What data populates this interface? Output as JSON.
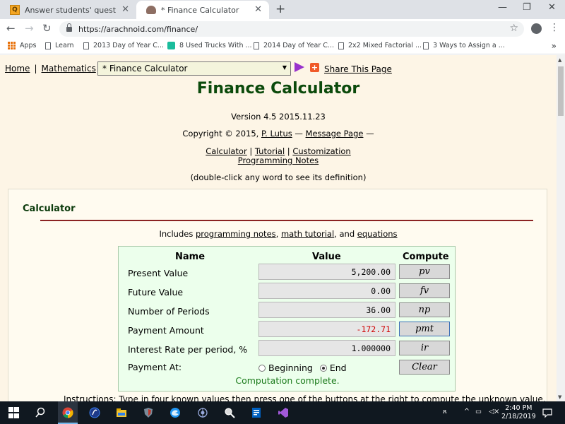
{
  "browser": {
    "tabs": [
      {
        "title": "Answer students' questions and l",
        "active": false
      },
      {
        "title": "* Finance Calculator",
        "active": true
      }
    ],
    "url": "https://arachnoid.com/finance/",
    "bookmarks": [
      "Apps",
      "Learn",
      "2013 Day of Year C...",
      "8 Used Trucks With ...",
      "2014 Day of Year C...",
      "2x2 Mixed Factorial ...",
      "3 Ways to Assign a ..."
    ]
  },
  "page": {
    "nav": {
      "home": "Home",
      "mathematics": "Mathematics",
      "select_value": "* Finance Calculator",
      "share": "Share This Page"
    },
    "title": "Finance Calculator",
    "version": "Version 4.5 2015.11.23",
    "copyright_prefix": "Copyright © 2015,",
    "author": "P. Lutus",
    "dash1": "—",
    "message_page": "Message Page",
    "dash2": "—",
    "links": {
      "calculator": "Calculator",
      "tutorial": "Tutorial",
      "customization": "Customization",
      "programming_notes": "Programming Notes"
    },
    "hint": "(double-click any word to see its definition)",
    "calculator": {
      "section_title": "Calculator",
      "includes_prefix": "Includes",
      "includes_link1": "programming notes",
      "includes_link2": "math tutorial",
      "includes_and": ", and",
      "includes_link3": "equations",
      "headers": {
        "name": "Name",
        "value": "Value",
        "compute": "Compute"
      },
      "rows": [
        {
          "label": "Present Value",
          "value": "5,200.00",
          "button": "pv"
        },
        {
          "label": "Future Value",
          "value": "0.00",
          "button": "fv"
        },
        {
          "label": "Number of Periods",
          "value": "36.00",
          "button": "np"
        },
        {
          "label": "Payment Amount",
          "value": "-172.71",
          "button": "pmt"
        },
        {
          "label": "Interest Rate per period, %",
          "value": "1.000000",
          "button": "ir"
        }
      ],
      "payment_at_label": "Payment At:",
      "option_beginning": "Beginning",
      "option_end": "End",
      "selected_option": "End",
      "clear": "Clear",
      "status": "Computation complete."
    },
    "instructions_fragment": "Instructions: Type in four known values then press one of the buttons at the right to compute the unknown value."
  },
  "taskbar": {
    "time": "2:40 PM",
    "date": "2/18/2019"
  },
  "colors": {
    "page_bg": "#fdf5e6",
    "title_green": "#0b4a0b",
    "calc_bg": "#ecffec",
    "negative_red": "#d00000",
    "status_green": "#1a7a1a"
  }
}
